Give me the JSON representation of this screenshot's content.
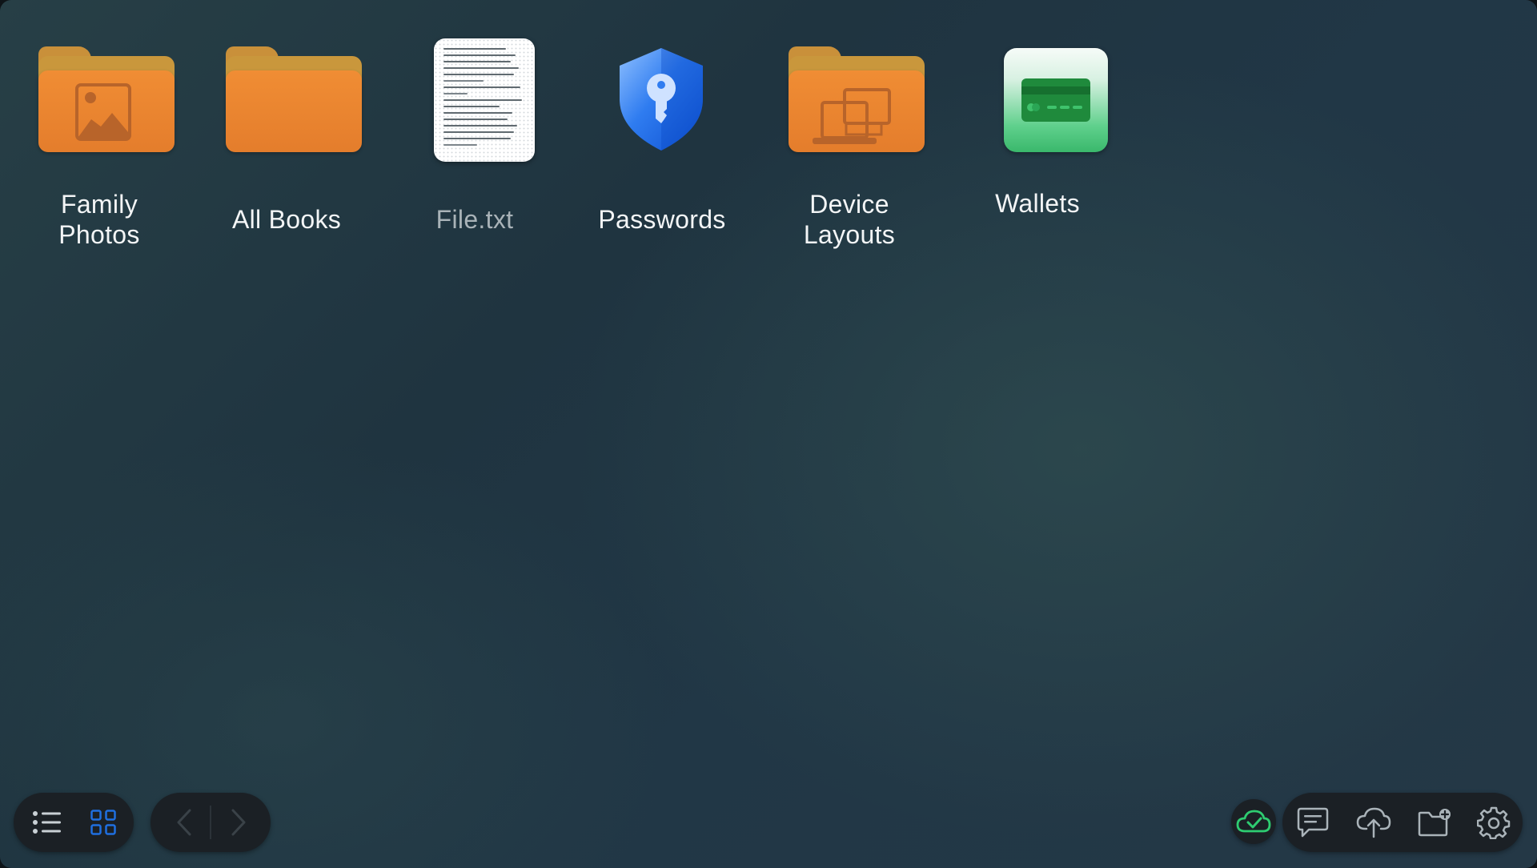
{
  "items": [
    {
      "label_line1": "Family",
      "label_line2": "Photos",
      "icon": "photo-folder-icon"
    },
    {
      "label": "All Books",
      "icon": "folder-icon"
    },
    {
      "label": "File.txt",
      "icon": "text-file-icon"
    },
    {
      "label": "Passwords",
      "icon": "key-shield-icon"
    },
    {
      "label_line1": "Device",
      "label_line2": "Layouts",
      "icon": "devices-folder-icon"
    },
    {
      "label": "Wallets",
      "icon": "credit-card-icon"
    }
  ],
  "toolbar": {
    "view_modes": [
      {
        "name": "list-view",
        "icon": "list-icon",
        "active": false
      },
      {
        "name": "grid-view",
        "icon": "grid-icon",
        "active": true
      }
    ],
    "navigation": [
      {
        "name": "back",
        "icon": "chevron-left-icon",
        "enabled": false
      },
      {
        "name": "forward",
        "icon": "chevron-right-icon",
        "enabled": false
      }
    ],
    "sync_status": {
      "icon": "cloud-check-icon",
      "color": "#2ecc71"
    },
    "actions": [
      {
        "name": "messages",
        "icon": "chat-icon"
      },
      {
        "name": "upload",
        "icon": "cloud-upload-icon"
      },
      {
        "name": "new-folder",
        "icon": "folder-add-icon"
      },
      {
        "name": "settings",
        "icon": "gear-icon"
      }
    ]
  },
  "colors": {
    "folder_front": "#f08d34",
    "folder_back": "#c9973c",
    "accent_blue": "#1f6fe0",
    "sync_green": "#2ecc71",
    "label_text": "#f3f5f6"
  }
}
